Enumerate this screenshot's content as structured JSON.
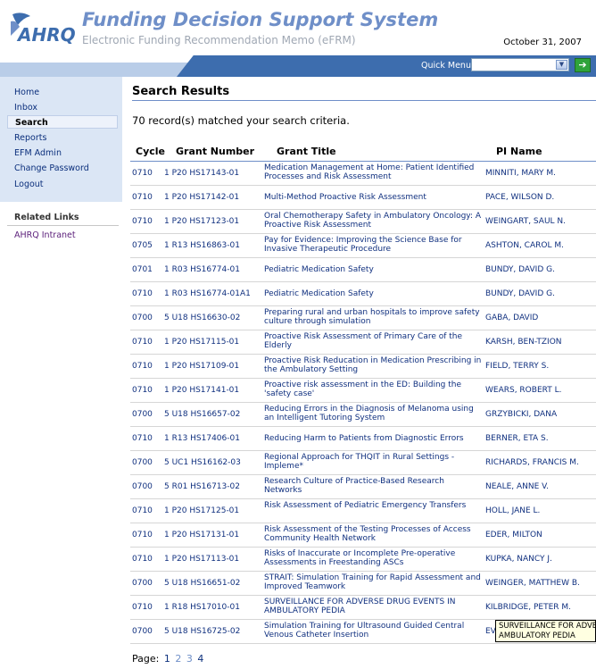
{
  "header": {
    "logo_text": "AHRQ",
    "title": "Funding Decision Support System",
    "subtitle": "Electronic Funding Recommendation Memo (eFRM)",
    "date": "October 31, 2007"
  },
  "menubar": {
    "quick_menu_label": "Quick Menu:",
    "quick_menu_value": ""
  },
  "sidebar": {
    "items": [
      {
        "label": "Home"
      },
      {
        "label": "Inbox"
      },
      {
        "label": "Search"
      },
      {
        "label": "Reports"
      },
      {
        "label": "EFM Admin"
      },
      {
        "label": "Change Password"
      },
      {
        "label": "Logout"
      }
    ],
    "active_index": 2,
    "related_title": "Related Links",
    "related_links": [
      {
        "label": "AHRQ Intranet"
      }
    ]
  },
  "main": {
    "page_title": "Search Results",
    "result_count": "70 record(s) matched your search criteria.",
    "columns": [
      "Cycle",
      "Grant Number",
      "Grant Title",
      "PI Name"
    ],
    "rows": [
      {
        "cycle": "0710",
        "grant": "1 P20 HS17143-01",
        "title": "Medication Management at Home: Patient Identified Processes and Risk Assessment",
        "pi": "MINNITI, MARY M."
      },
      {
        "cycle": "0710",
        "grant": "1 P20 HS17142-01",
        "title": "Multi-Method Proactive Risk Assessment",
        "pi": "PACE, WILSON D."
      },
      {
        "cycle": "0710",
        "grant": "1 P20 HS17123-01",
        "title": "Oral Chemotherapy Safety in Ambulatory Oncology: A Proactive Risk Assessment",
        "pi": "WEINGART, SAUL N."
      },
      {
        "cycle": "0705",
        "grant": "1 R13 HS16863-01",
        "title": "Pay for Evidence: Improving the Science Base for Invasive Therapeutic Procedure",
        "pi": "ASHTON, CAROL M."
      },
      {
        "cycle": "0701",
        "grant": "1 R03 HS16774-01",
        "title": "Pediatric Medication Safety",
        "pi": "BUNDY, DAVID G."
      },
      {
        "cycle": "0710",
        "grant": "1 R03 HS16774-01A1",
        "title": "Pediatric Medication Safety",
        "pi": "BUNDY, DAVID G."
      },
      {
        "cycle": "0700",
        "grant": "5 U18 HS16630-02",
        "title": "Preparing rural and urban hospitals to improve safety culture through simulation",
        "pi": "GABA, DAVID"
      },
      {
        "cycle": "0710",
        "grant": "1 P20 HS17115-01",
        "title": "Proactive Risk Assessment of Primary Care of the Elderly",
        "pi": "KARSH, BEN-TZION"
      },
      {
        "cycle": "0710",
        "grant": "1 P20 HS17109-01",
        "title": "Proactive Risk Reducation in Medication Prescribing in the Ambulatory Setting",
        "pi": "FIELD, TERRY S."
      },
      {
        "cycle": "0710",
        "grant": "1 P20 HS17141-01",
        "title": "Proactive risk assessment in the ED: Building the 'safety case'",
        "pi": "WEARS, ROBERT L."
      },
      {
        "cycle": "0700",
        "grant": "5 U18 HS16657-02",
        "title": "Reducing Errors in the Diagnosis of Melanoma using an Intelligent Tutoring System",
        "pi": "GRZYBICKI, DANA"
      },
      {
        "cycle": "0710",
        "grant": "1 R13 HS17406-01",
        "title": "Reducing Harm to Patients from Diagnostic Errors",
        "pi": "BERNER, ETA S."
      },
      {
        "cycle": "0700",
        "grant": "5 UC1 HS16162-03",
        "title": "Regional Approach for THQIT in Rural Settings - Impleme*",
        "pi": "RICHARDS, FRANCIS M."
      },
      {
        "cycle": "0700",
        "grant": "5 R01 HS16713-02",
        "title": "Research Culture of Practice-Based Research Networks",
        "pi": "NEALE, ANNE V."
      },
      {
        "cycle": "0710",
        "grant": "1 P20 HS17125-01",
        "title": "Risk Assessment of Pediatric Emergency Transfers",
        "pi": "HOLL, JANE L."
      },
      {
        "cycle": "0710",
        "grant": "1 P20 HS17131-01",
        "title": "Risk Assessment of the Testing Processes of Access Community Health Network",
        "pi": "EDER, MILTON"
      },
      {
        "cycle": "0710",
        "grant": "1 P20 HS17113-01",
        "title": "Risks of Inaccurate or Incomplete Pre-operative Assessments in Freestanding ASCs",
        "pi": "KUPKA, NANCY J."
      },
      {
        "cycle": "0700",
        "grant": "5 U18 HS16651-02",
        "title": "STRAIT: Simulation Training for Rapid Assessment and Improved Teamwork",
        "pi": "WEINGER, MATTHEW B."
      },
      {
        "cycle": "0710",
        "grant": "1 R18 HS17010-01",
        "title": "SURVEILLANCE FOR ADVERSE DRUG EVENTS IN AMBULATORY PEDIA",
        "pi": "KILBRIDGE, PETER M."
      },
      {
        "cycle": "0700",
        "grant": "5 U18 HS16725-02",
        "title": "Simulation Training for Ultrasound Guided Central Venous Catheter Insertion",
        "pi": "EV"
      }
    ],
    "tooltip_line1": "SURVEILLANCE FOR ADVERSE",
    "tooltip_line2": "AMBULATORY PEDIA",
    "pagination_label": "Page:",
    "pages": [
      "1",
      "2",
      "3",
      "4"
    ]
  },
  "colors": {
    "title_blue": "#6f8fc8",
    "link_blue": "#10307f",
    "nav_bg": "#dbe6f5",
    "menubar_dark": "#3d6dae",
    "go_green": "#2fa33a"
  },
  "icons": {
    "dropdown": "chevron-down-icon",
    "go": "arrow-right-icon"
  }
}
